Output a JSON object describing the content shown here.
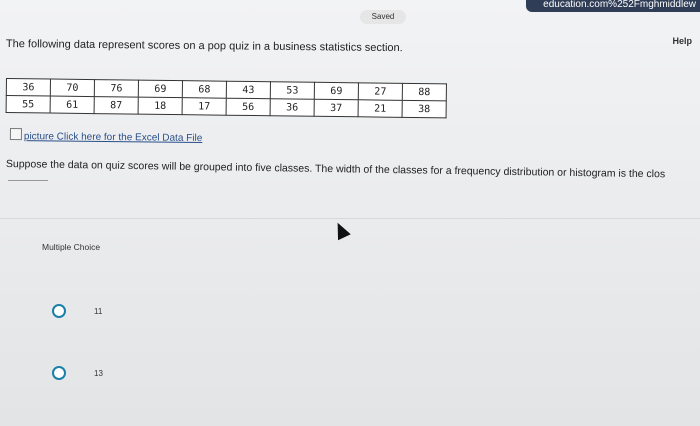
{
  "topbar": {
    "url_fragment": "education.com%252Fmghmiddlew",
    "saved_label": "Saved"
  },
  "help_label": "Help",
  "question_intro": "The following data represent scores on a pop quiz in a business statistics section.",
  "data_table": {
    "rows": [
      [
        "36",
        "70",
        "76",
        "69",
        "68",
        "43",
        "53",
        "69",
        "27",
        "88"
      ],
      [
        "55",
        "61",
        "87",
        "18",
        "17",
        "56",
        "36",
        "37",
        "21",
        "38"
      ]
    ]
  },
  "excel_link": "picture Click here for the Excel Data File",
  "prompt": "Suppose the data on quiz scores will be grouped into five classes. The width of the classes for a frequency distribution or histogram is the clos",
  "multiple_choice_label": "Multiple Choice",
  "options": [
    {
      "label": "11"
    },
    {
      "label": "13"
    }
  ]
}
